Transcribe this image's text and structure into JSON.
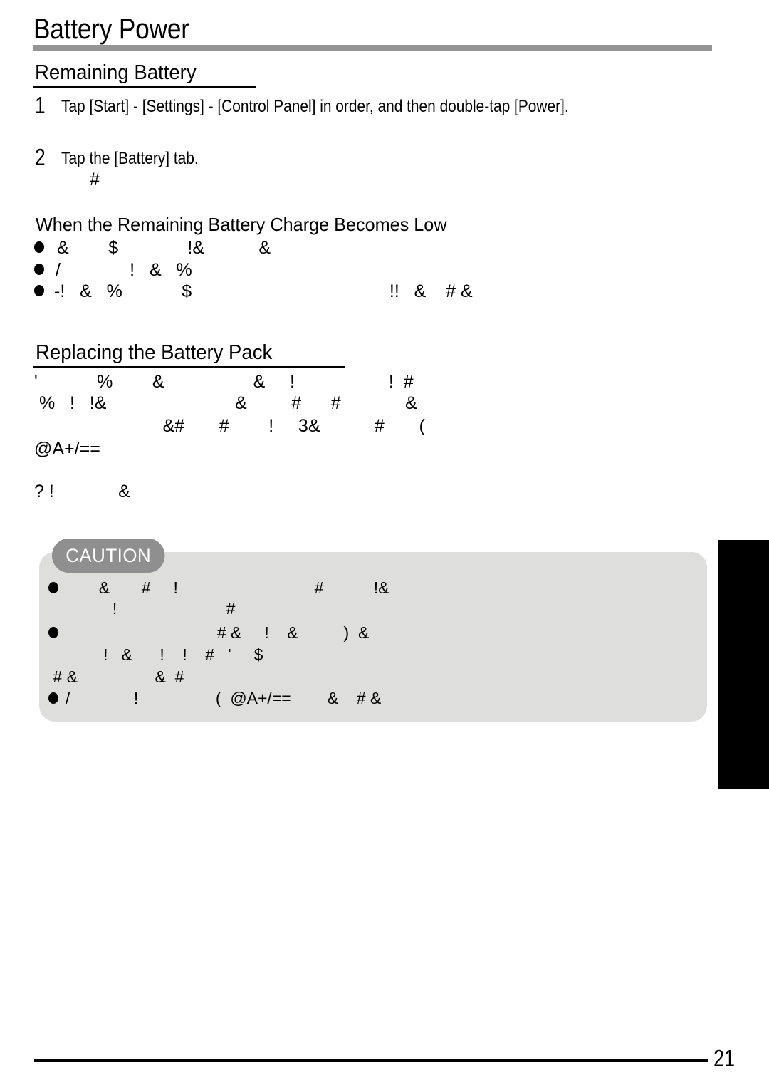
{
  "document": {
    "title": "Battery Power",
    "page_number": "21"
  },
  "sections": {
    "remaining_battery": {
      "heading": "Remaining Battery",
      "steps": [
        {
          "number": "1",
          "text": "Tap [Start] - [Settings] - [Control Panel] in order, and then double-tap [Power]."
        },
        {
          "number": "2",
          "text": "Tap the [Battery] tab.",
          "note_glyphs": "#"
        }
      ]
    },
    "low_charge": {
      "heading": "When the Remaining Battery Charge Becomes Low",
      "bullets": [
        "&        $              !&           &",
        "/              !   &   %",
        "-!   &   %            $                                        !!   &    # &"
      ]
    },
    "replacing_battery": {
      "heading": "Replacing the Battery Pack",
      "body_lines": [
        "'            %        &                  &     !                   !  #",
        " %   !   !&                          &         #      #             &",
        "                          &#       #        !     3&           #       (",
        "@A+/==",
        "",
        "? !             &"
      ]
    },
    "caution": {
      "badge_label": "CAUTION",
      "bullets": [
        {
          "marker": "●",
          "lines": [
            "       &       #     !                              #           !&",
            "          !                        #"
          ]
        },
        {
          "marker": "●",
          "lines": [
            "                                 # &     !    &          )  &",
            "        !   &      !    !    #   '     $",
            " # &                 &  #"
          ]
        },
        {
          "marker": "●",
          "lines": [
            "/              !                 (  @A+/==        &    # &"
          ]
        }
      ]
    }
  },
  "colors": {
    "title_rule": "#949494",
    "caution_box_bg": "#dededd",
    "caution_badge_bg": "#8f8f8f",
    "side_tab": "#000000",
    "text": "#000000"
  }
}
